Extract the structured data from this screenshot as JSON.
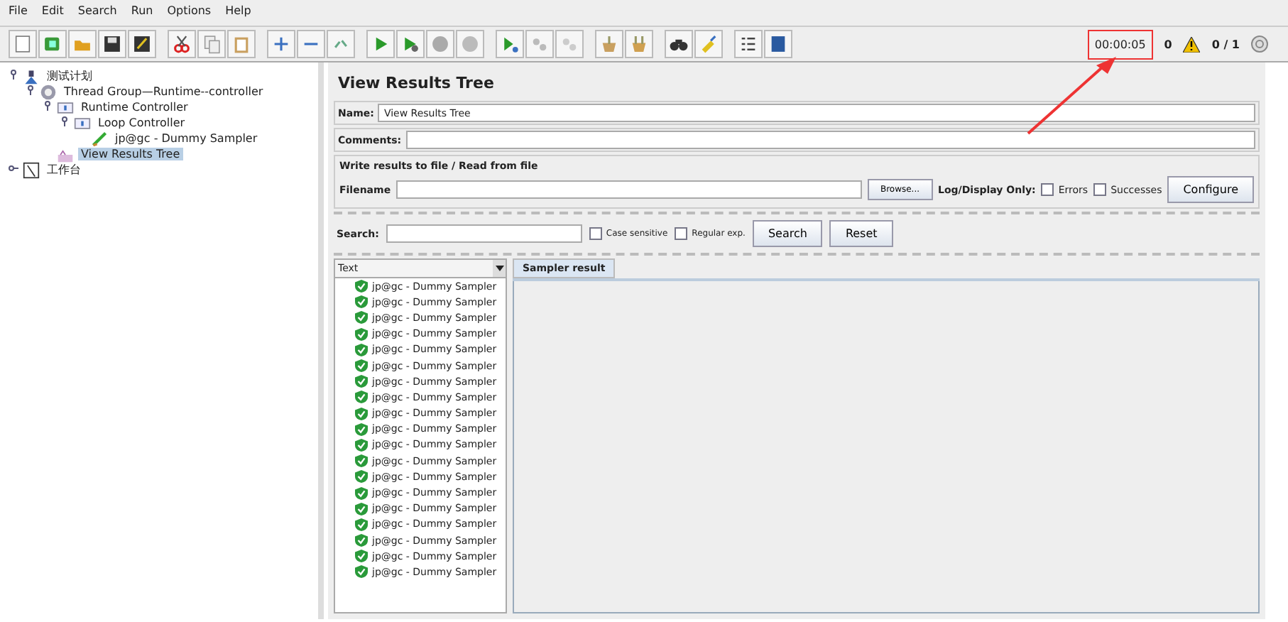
{
  "menu": [
    "File",
    "Edit",
    "Search",
    "Run",
    "Options",
    "Help"
  ],
  "status": {
    "timer": "00:00:05",
    "warnings": "0",
    "threads": "0 / 1"
  },
  "tree": [
    {
      "label": "测试计划",
      "kind": "plan",
      "expanded": true,
      "selected": false,
      "children": [
        {
          "label": "Thread Group—Runtime--controller",
          "kind": "group",
          "expanded": true,
          "selected": false,
          "children": [
            {
              "label": "Runtime Controller",
              "kind": "controller",
              "expanded": true,
              "selected": false,
              "children": [
                {
                  "label": "Loop Controller",
                  "kind": "controller",
                  "expanded": true,
                  "selected": false,
                  "children": [
                    {
                      "label": "jp@gc - Dummy Sampler",
                      "kind": "sampler",
                      "selected": false
                    }
                  ]
                }
              ]
            },
            {
              "label": "View Results Tree",
              "kind": "listener",
              "selected": true
            }
          ]
        }
      ]
    },
    {
      "label": "工作台",
      "kind": "workbench",
      "expanded": false,
      "selected": false
    }
  ],
  "panel": {
    "title": "View Results Tree",
    "name_label": "Name:",
    "name_value": "View Results Tree",
    "comments_label": "Comments:",
    "file_section": "Write results to file / Read from file",
    "filename_label": "Filename",
    "browse": "Browse...",
    "log_only": "Log/Display Only:",
    "checks": [
      {
        "label": "Errors",
        "checked": false
      },
      {
        "label": "Successes",
        "checked": false
      }
    ],
    "configure": "Configure",
    "search_label": "Search:",
    "search_checks": [
      {
        "label": "Case sensitive",
        "checked": false
      },
      {
        "label": "Regular exp.",
        "checked": false
      }
    ],
    "search_button": "Search",
    "reset_button": "Reset",
    "renderer": "Text",
    "tabs": [
      {
        "label": "Sampler result",
        "selected": true
      }
    ],
    "results": [
      "jp@gc - Dummy Sampler",
      "jp@gc - Dummy Sampler",
      "jp@gc - Dummy Sampler",
      "jp@gc - Dummy Sampler",
      "jp@gc - Dummy Sampler",
      "jp@gc - Dummy Sampler",
      "jp@gc - Dummy Sampler",
      "jp@gc - Dummy Sampler",
      "jp@gc - Dummy Sampler",
      "jp@gc - Dummy Sampler",
      "jp@gc - Dummy Sampler",
      "jp@gc - Dummy Sampler",
      "jp@gc - Dummy Sampler",
      "jp@gc - Dummy Sampler",
      "jp@gc - Dummy Sampler",
      "jp@gc - Dummy Sampler",
      "jp@gc - Dummy Sampler",
      "jp@gc - Dummy Sampler",
      "jp@gc - Dummy Sampler"
    ]
  }
}
